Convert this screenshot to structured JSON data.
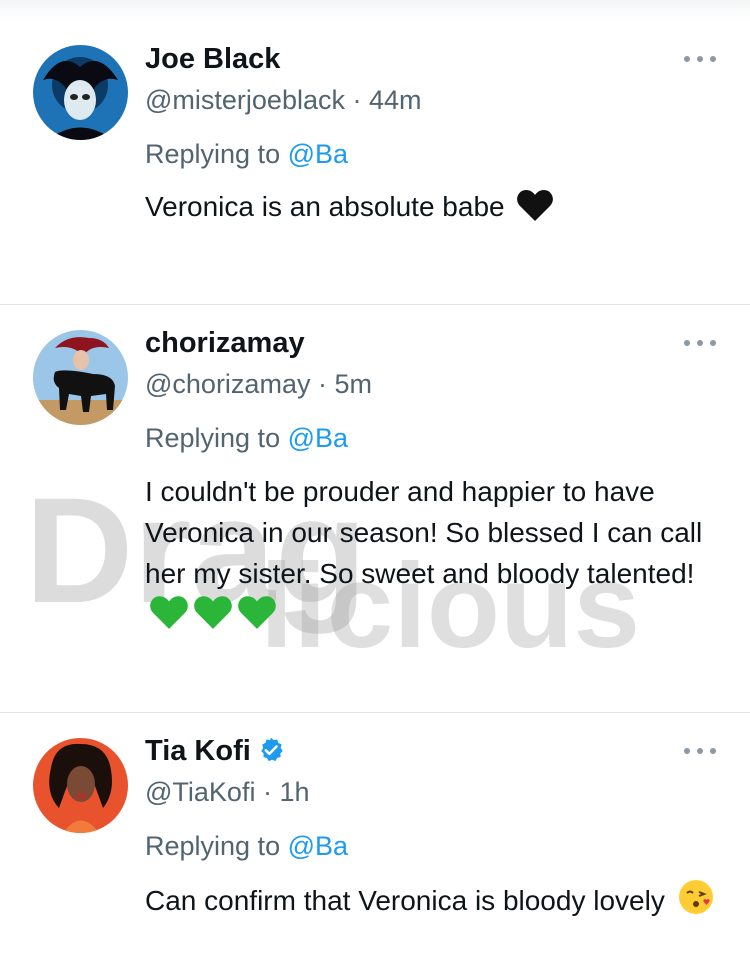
{
  "tweets": [
    {
      "name": "Joe Black",
      "handle": "@misterjoeblack",
      "separator": "·",
      "time": "44m",
      "replying_prefix": "Replying to",
      "replying_mention": "@Ba",
      "text": "Veronica is an absolute babe",
      "emoji": [
        "black-heart"
      ]
    },
    {
      "name": "chorizamay",
      "handle": "@chorizamay",
      "separator": "·",
      "time": "5m",
      "replying_prefix": "Replying to",
      "replying_mention": "@Ba",
      "text": "I couldn't be prouder and happier to have Veronica in our season! So blessed I can call her my sister. So sweet  and bloody talented!",
      "emoji": [
        "green-heart",
        "green-heart",
        "green-heart"
      ]
    },
    {
      "name": "Tia Kofi",
      "verified": true,
      "handle": "@TiaKofi",
      "separator": "·",
      "time": "1h",
      "replying_prefix": "Replying to",
      "replying_mention": "@Ba",
      "text": "Can confirm that Veronica is bloody lovely",
      "emoji": [
        "face-blowing-kiss"
      ]
    }
  ],
  "watermark": {
    "line1": "Drag",
    "line2": "licious"
  },
  "colors": {
    "primary_text": "#0f1419",
    "secondary_text": "#536471",
    "mention": "#1d9bf0",
    "divider": "#dfe3e6",
    "verified": "#1d9bf0",
    "green_heart": "#2bb63a"
  }
}
